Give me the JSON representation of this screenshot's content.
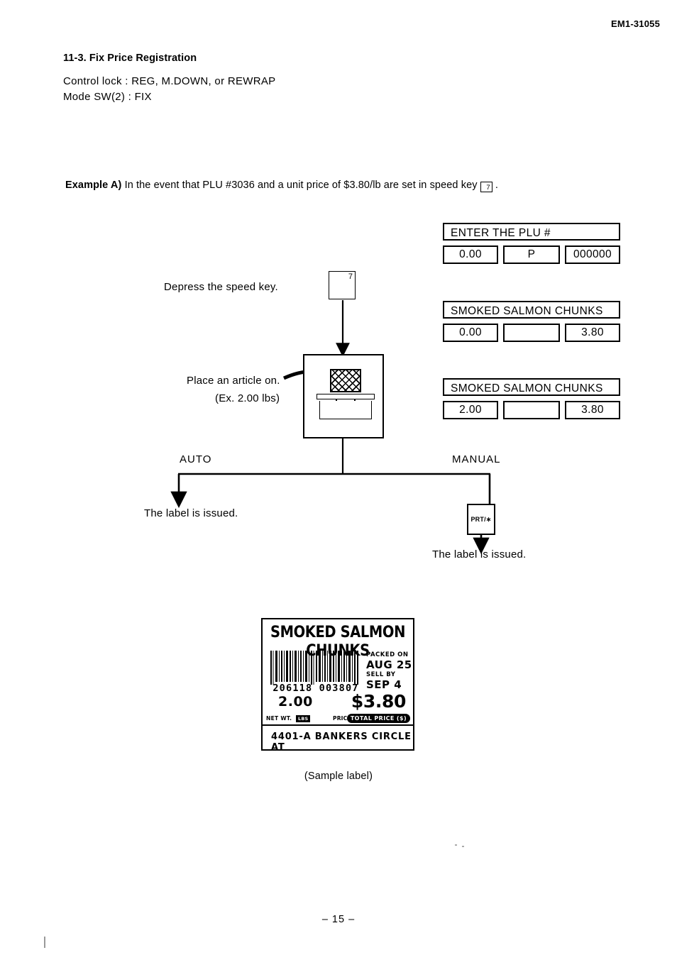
{
  "header": {
    "doc_code": "EM1-31055"
  },
  "section": {
    "heading": "11-3. Fix Price Registration",
    "control_lock": "Control lock  :  REG, M.DOWN, or REWRAP",
    "mode_sw": "Mode SW(2) :  FIX"
  },
  "example": {
    "label": "Example A)",
    "text_before_key": "In the event that PLU #3036 and a unit price of $3.80/lb are set in speed key",
    "key_label": "7",
    "text_after_key": "."
  },
  "displays": [
    {
      "title": "ENTER THE PLU #",
      "weight": "0.00",
      "middle": "P",
      "price": "000000"
    },
    {
      "title": "SMOKED SALMON CHUNKS",
      "weight": "0.00",
      "middle": "",
      "price": "3.80"
    },
    {
      "title": "SMOKED SALMON CHUNKS",
      "weight": "2.00",
      "middle": "",
      "price": "3.80"
    }
  ],
  "flow": {
    "depress_speed_key": "Depress the speed key.",
    "speed_key_label": "7",
    "place_article": "Place an article on.",
    "place_article_example": "(Ex. 2.00 lbs)",
    "branch_auto": "AUTO",
    "branch_manual": "MANUAL",
    "auto_result": "The label is issued.",
    "prt_key_label": "PRT/∗",
    "manual_result": "The label is issued."
  },
  "sample_label": {
    "product_name": "SMOKED SALMON CHUNKS",
    "barcode_digits": "206118 003807",
    "packed_on_caption": "PACKED ON",
    "packed_on_value": "AUG 25",
    "sell_by_caption": "SELL BY",
    "sell_by_value": "SEP 4",
    "net_weight": "2.00",
    "total_price": "$3.80",
    "net_wt_caption": "NET WT.",
    "net_wt_unit": "LBS",
    "price_per_unit_caption": "PRICE/lb $",
    "total_price_caption": "TOTAL PRICE ($)",
    "address": "4401-A BANKERS CIRCLE AT",
    "caption": "(Sample label)"
  },
  "footer": {
    "page_number": "– 15 –"
  }
}
